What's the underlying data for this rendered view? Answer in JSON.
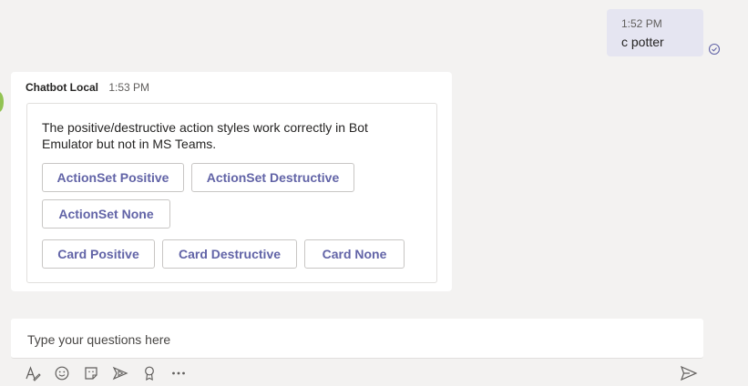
{
  "user_message": {
    "time": "1:52 PM",
    "text": "c potter"
  },
  "bot_message": {
    "sender": "Chatbot Local",
    "time": "1:53 PM",
    "card": {
      "text": "The positive/destructive action styles work correctly in Bot Emulator but not in MS Teams.",
      "actions": [
        "ActionSet Positive",
        "ActionSet Destructive",
        "ActionSet None",
        "Card Positive",
        "Card Destructive",
        "Card None"
      ]
    }
  },
  "compose": {
    "placeholder": "Type your questions here"
  },
  "toolbar": {
    "icons": [
      "format-icon",
      "emoji-icon",
      "sticker-icon",
      "stream-icon",
      "praise-icon",
      "more-icon",
      "send-icon"
    ]
  },
  "colors": {
    "accent": "#6264a7",
    "background": "#f3f2f1",
    "user_bubble": "#e5e5f1",
    "bot_avatar": "#92c353"
  }
}
